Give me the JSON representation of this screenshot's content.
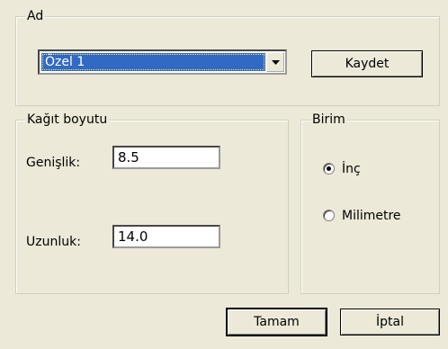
{
  "name_group": {
    "title": "Ad",
    "select_value": "Özel 1",
    "save_label": "Kaydet"
  },
  "paper_size_group": {
    "title": "Kağıt boyutu",
    "width_label": "Genişlik:",
    "width_value": "8.5",
    "height_label": "Uzunluk:",
    "height_value": "14.0"
  },
  "unit_group": {
    "title": "Birim",
    "options": [
      {
        "label": "İnç",
        "selected": true
      },
      {
        "label": "Milimetre",
        "selected": false
      }
    ]
  },
  "buttons": {
    "ok_label": "Tamam",
    "cancel_label": "İptal"
  },
  "icons": {
    "dropdown": "chevron-down-icon"
  }
}
